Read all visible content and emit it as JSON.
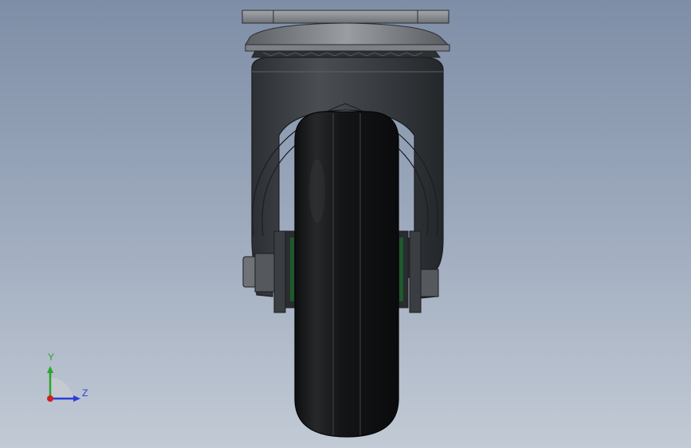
{
  "viewport": {
    "background_top": "#7e8ea6",
    "background_bottom": "#c2cad5"
  },
  "model": {
    "name": "swivel-caster-wheel",
    "view": "front",
    "colors": {
      "mount_plate": "#8a8d92",
      "fork_body": "#3b3e42",
      "wheel": "#141516",
      "bearing": "#1d5a2c"
    }
  },
  "triad": {
    "y_label": "Y",
    "z_label": "Z",
    "y_color": "#2aa52a",
    "z_color": "#2a3fd8",
    "x_color": "#d02020"
  }
}
